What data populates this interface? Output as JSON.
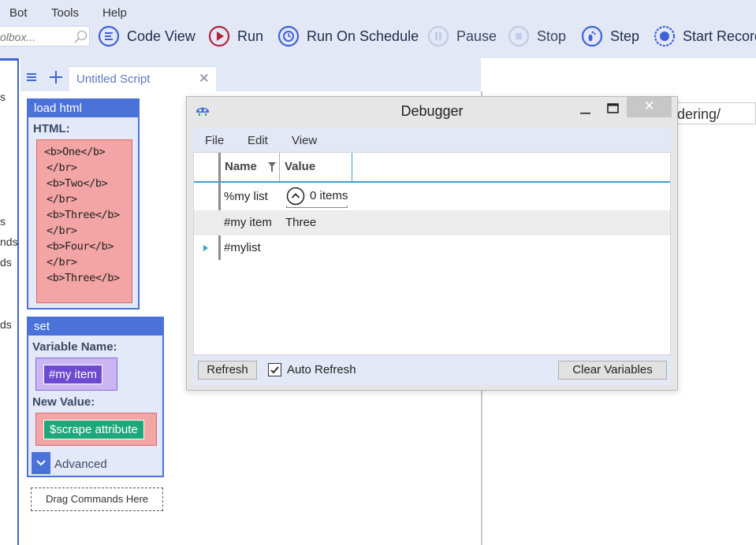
{
  "menu": {
    "bot": "Bot",
    "tools": "Tools",
    "help": "Help"
  },
  "search": {
    "placeholder": "olbox..."
  },
  "toolbar": {
    "code_view": "Code View",
    "run": "Run",
    "run_on_schedule": "Run On Schedule",
    "pause": "Pause",
    "stop": "Stop",
    "step": "Step",
    "start_recording": "Start Record"
  },
  "left_strip": {
    "items": [
      "s",
      "s",
      "nds",
      "ds",
      "ds"
    ]
  },
  "tab": {
    "title": "Untitled Script",
    "close_glyph": "✕"
  },
  "blocks": {
    "load_html": {
      "title": "load html",
      "html_label": "HTML:",
      "html_lines": [
        "<b>One</b>",
        "</br>",
        "<b>Two</b>",
        "</br>",
        "<b>Three</b>",
        "</br>",
        "<b>Four</b>",
        "</br>",
        "<b>Three</b>"
      ]
    },
    "set": {
      "title": "set",
      "variable_label": "Variable Name:",
      "variable_value": "#my item",
      "new_value_label": "New Value:",
      "new_value": "$scrape attribute",
      "advanced_label": "Advanced"
    },
    "drop_zone": "Drag Commands Here"
  },
  "right_pane": {
    "url_fragment": "dering/"
  },
  "debugger": {
    "title": "Debugger",
    "close_glyph": "✕",
    "menu": {
      "file": "File",
      "edit": "Edit",
      "view": "View"
    },
    "columns": {
      "name": "Name",
      "value": "Value"
    },
    "rows": [
      {
        "name": "%my list",
        "value": "0 items"
      },
      {
        "name": "#my item",
        "value": "Three"
      },
      {
        "name": "#mylist",
        "value": ""
      }
    ],
    "refresh_label": "Refresh",
    "auto_refresh_label": "Auto Refresh",
    "auto_refresh_checked": true,
    "clear_label": "Clear Variables"
  },
  "colors": {
    "accent_blue": "#4a72d8",
    "run_red": "#b3243b",
    "html_box": "#f3a4a4",
    "variable_purple": "#6c4bd0",
    "value_green": "#1ca879",
    "grid_rule": "#3aa3c8"
  }
}
